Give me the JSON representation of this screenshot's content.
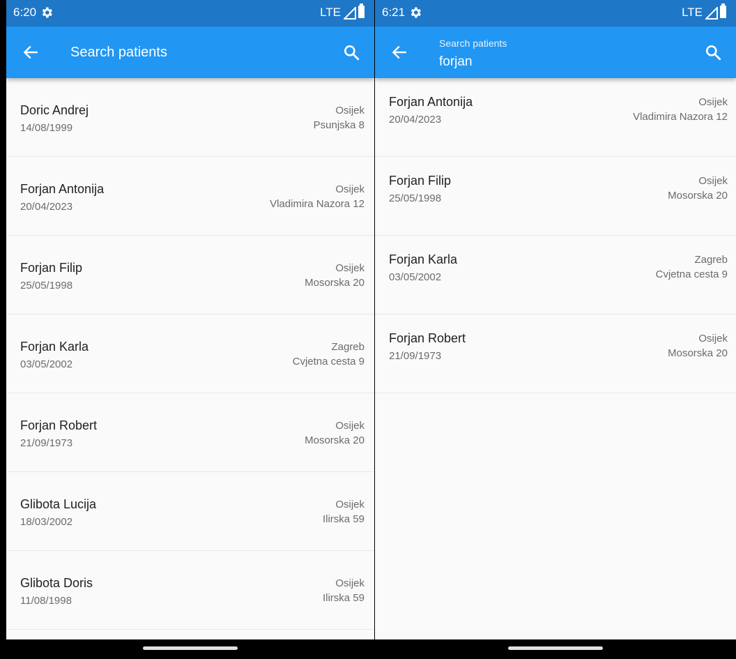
{
  "left": {
    "status": {
      "time": "6:20",
      "network": "LTE"
    },
    "app_bar": {
      "title": "Search patients"
    },
    "patients": [
      {
        "name": "Doric Andrej",
        "dob": "14/08/1999",
        "city": "Osijek",
        "street": "Psunjska 8"
      },
      {
        "name": "Forjan Antonija",
        "dob": "20/04/2023",
        "city": "Osijek",
        "street": "Vladimira Nazora 12"
      },
      {
        "name": "Forjan Filip",
        "dob": "25/05/1998",
        "city": "Osijek",
        "street": "Mosorska 20"
      },
      {
        "name": "Forjan Karla",
        "dob": "03/05/2002",
        "city": "Zagreb",
        "street": "Cvjetna cesta 9"
      },
      {
        "name": "Forjan Robert",
        "dob": "21/09/1973",
        "city": "Osijek",
        "street": "Mosorska 20"
      },
      {
        "name": "Glibota Lucija",
        "dob": "18/03/2002",
        "city": "Osijek",
        "street": "Ilirska 59"
      },
      {
        "name": "Glibota Doris",
        "dob": "11/08/1998",
        "city": "Osijek",
        "street": "Ilirska 59"
      }
    ]
  },
  "right": {
    "status": {
      "time": "6:21",
      "network": "LTE"
    },
    "app_bar": {
      "search_label": "Search patients",
      "search_value": "forjan"
    },
    "patients": [
      {
        "name": "Forjan Antonija",
        "dob": "20/04/2023",
        "city": "Osijek",
        "street": "Vladimira Nazora 12"
      },
      {
        "name": "Forjan Filip",
        "dob": "25/05/1998",
        "city": "Osijek",
        "street": "Mosorska 20"
      },
      {
        "name": "Forjan Karla",
        "dob": "03/05/2002",
        "city": "Zagreb",
        "street": "Cvjetna cesta 9"
      },
      {
        "name": "Forjan Robert",
        "dob": "21/09/1973",
        "city": "Osijek",
        "street": "Mosorska 20"
      }
    ]
  },
  "icons": {
    "status_settings": "gear-icon",
    "status_signal": "signal-icon",
    "status_battery": "battery-icon",
    "back": "arrow-back-icon",
    "search": "search-icon"
  },
  "colors": {
    "status_bar": "#1f77c8",
    "app_bar": "#2196f3",
    "background": "#fafafa",
    "primary_text": "#212121",
    "secondary_text": "#6b6b6b"
  }
}
